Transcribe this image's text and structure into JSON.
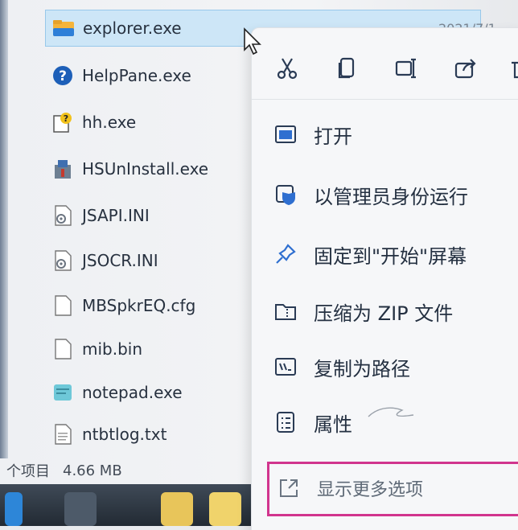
{
  "files": [
    {
      "name": "explorer.exe",
      "date": "2021/7/1",
      "icon": "folder-app-icon",
      "selected": true
    },
    {
      "name": "HelpPane.exe",
      "icon": "help-icon"
    },
    {
      "name": "hh.exe",
      "icon": "help-file-icon"
    },
    {
      "name": "HSUnInstall.exe",
      "icon": "installer-icon"
    },
    {
      "name": "JSAPI.INI",
      "icon": "config-file-icon"
    },
    {
      "name": "JSOCR.INI",
      "icon": "config-file-icon"
    },
    {
      "name": "MBSpkrEQ.cfg",
      "icon": "file-icon"
    },
    {
      "name": "mib.bin",
      "icon": "file-icon"
    },
    {
      "name": "notepad.exe",
      "icon": "notepad-icon"
    },
    {
      "name": "ntbtlog.txt",
      "icon": "text-file-icon"
    }
  ],
  "status": {
    "items": "个项目",
    "size": "4.66 MB"
  },
  "toolbar": [
    "cut-icon",
    "copy-icon",
    "rename-icon",
    "share-icon"
  ],
  "menu": [
    {
      "label": "打开",
      "icon": "open-icon"
    },
    {
      "label": "以管理员身份运行",
      "icon": "shield-icon"
    },
    {
      "label": "固定到\"开始\"屏幕",
      "icon": "pin-icon"
    },
    {
      "label": "压缩为 ZIP 文件",
      "icon": "zip-icon"
    },
    {
      "label": "复制为路径",
      "icon": "copy-path-icon"
    },
    {
      "label": "属性",
      "icon": "properties-icon"
    }
  ],
  "more_options": {
    "label": "显示更多选项",
    "icon": "expand-icon"
  },
  "colors": {
    "highlight": "#d1358e",
    "selection": "#cde6f7"
  }
}
